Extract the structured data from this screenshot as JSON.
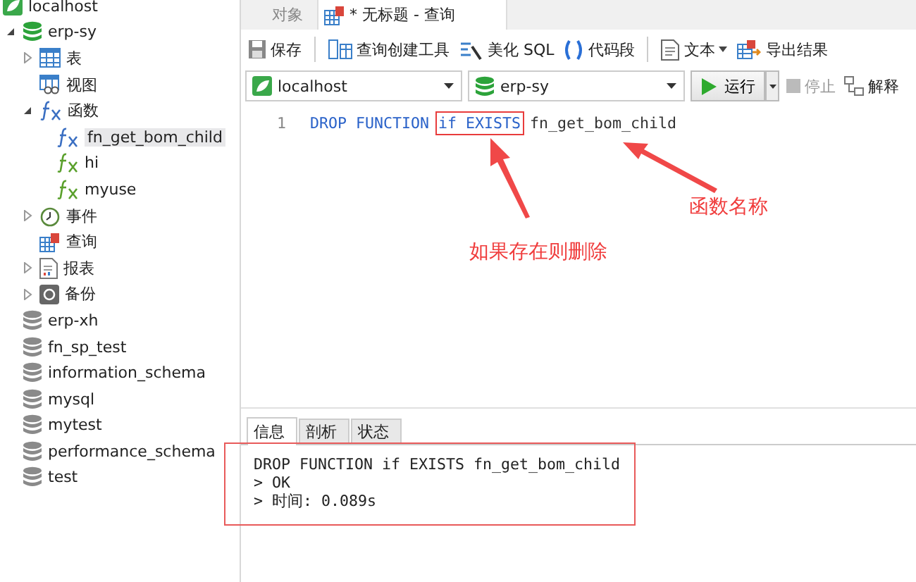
{
  "sidebar": {
    "tree": [
      {
        "label": "localhost",
        "kind": "connection",
        "children": [
          {
            "label": "erp-sy",
            "kind": "database",
            "open": true,
            "expanded": true,
            "children": [
              {
                "label": "表",
                "kind": "tables",
                "expanded": false
              },
              {
                "label": "视图",
                "kind": "views"
              },
              {
                "label": "函数",
                "kind": "functions",
                "expanded": true,
                "children": [
                  {
                    "label": "fn_get_bom_child",
                    "kind": "function",
                    "selected": true
                  },
                  {
                    "label": "hi",
                    "kind": "procedure",
                    "selected": false
                  },
                  {
                    "label": "myuse",
                    "kind": "procedure",
                    "selected": false
                  }
                ]
              },
              {
                "label": "事件",
                "kind": "events",
                "expanded": false
              },
              {
                "label": "查询",
                "kind": "queries"
              },
              {
                "label": "报表",
                "kind": "reports",
                "expanded": false
              },
              {
                "label": "备份",
                "kind": "backups",
                "expanded": false
              }
            ]
          },
          {
            "label": "erp-xh",
            "kind": "database",
            "open": false
          },
          {
            "label": "fn_sp_test",
            "kind": "database",
            "open": false
          },
          {
            "label": "information_schema",
            "kind": "database",
            "open": false
          },
          {
            "label": "mysql",
            "kind": "database",
            "open": false
          },
          {
            "label": "mytest",
            "kind": "database",
            "open": false
          },
          {
            "label": "performance_schema",
            "kind": "database",
            "open": false
          },
          {
            "label": "test",
            "kind": "database",
            "open": false
          }
        ]
      }
    ]
  },
  "tabs": [
    {
      "label": "对象",
      "selected": false,
      "icon": false
    },
    {
      "label": "* 无标题 - 查询",
      "selected": true,
      "icon": true
    }
  ],
  "toolbar": [
    {
      "label": "保存",
      "kind": "save"
    },
    {
      "kind": "separator"
    },
    {
      "label": "查询创建工具",
      "kind": "builder"
    },
    {
      "label": "美化 SQL",
      "kind": "beautify"
    },
    {
      "label": "代码段",
      "kind": "snippet"
    },
    {
      "kind": "separator"
    },
    {
      "label": "文本",
      "kind": "text",
      "dropdown": true
    },
    {
      "label": "导出结果",
      "kind": "export"
    }
  ],
  "connection_select": {
    "value": "localhost"
  },
  "database_select": {
    "value": "erp-sy"
  },
  "run_button": {
    "label": "运行"
  },
  "stop_button": {
    "label": "停止",
    "disabled": true
  },
  "explain_button": {
    "label": "解释"
  },
  "editor": {
    "lines": [
      {
        "number": "1",
        "tokens": [
          {
            "text": "DROP FUNCTION",
            "kind": "keyword",
            "highlighted": false
          },
          {
            "text": "if EXISTS",
            "kind": "keyword",
            "highlighted": true
          },
          {
            "text": "fn_get_bom_child",
            "kind": "identifier",
            "highlighted": false
          }
        ]
      }
    ]
  },
  "annotations": [
    {
      "text": "如果存在则删除"
    },
    {
      "text": "函数名称"
    }
  ],
  "result_tabs": [
    {
      "label": "信息",
      "selected": true
    },
    {
      "label": "剖析",
      "selected": false
    },
    {
      "label": "状态",
      "selected": false
    }
  ],
  "messages": {
    "framed": true,
    "lines": [
      "DROP FUNCTION if EXISTS fn_get_bom_child",
      "> OK",
      "> 时间: 0.089s"
    ]
  }
}
